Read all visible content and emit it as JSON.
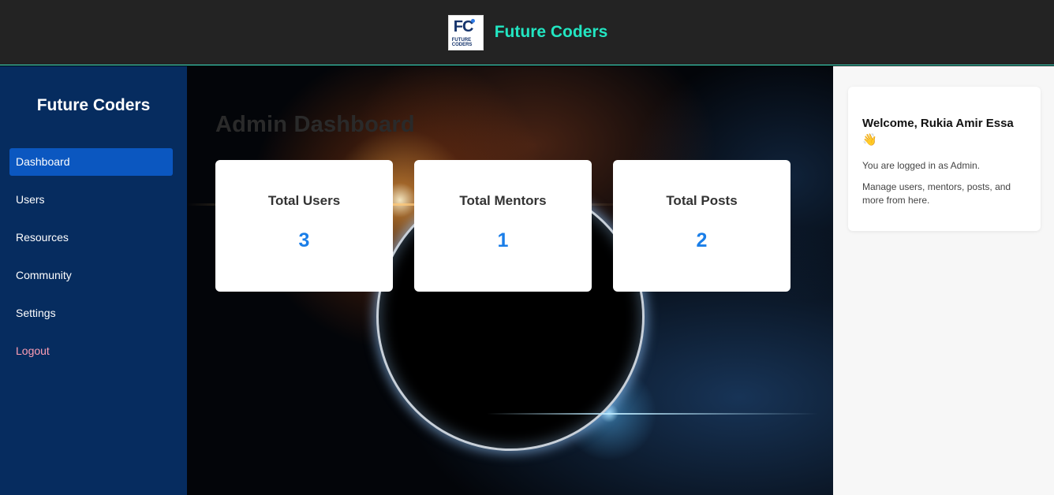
{
  "header": {
    "logo_text": "FC",
    "logo_subtext": "FUTURE CODERS",
    "brand_name": "Future Coders"
  },
  "sidebar": {
    "title": "Future Coders",
    "items": [
      {
        "label": "Dashboard",
        "active": true
      },
      {
        "label": "Users"
      },
      {
        "label": "Resources"
      },
      {
        "label": "Community"
      },
      {
        "label": "Settings"
      },
      {
        "label": "Logout"
      }
    ]
  },
  "main": {
    "title": "Admin Dashboard",
    "stats": [
      {
        "label": "Total Users",
        "value": "3"
      },
      {
        "label": "Total Mentors",
        "value": "1"
      },
      {
        "label": "Total Posts",
        "value": "2"
      }
    ]
  },
  "welcome": {
    "title": "Welcome, Rukia Amir Essa 👋",
    "line1": "You are logged in as Admin.",
    "line2": "Manage users, mentors, posts, and more from here."
  },
  "colors": {
    "accent": "#22e6c2",
    "sidebar_bg": "#062c5f",
    "active_item": "#0b57c0",
    "stat_value": "#1a7ee8",
    "logout": "#ff9fb5"
  }
}
